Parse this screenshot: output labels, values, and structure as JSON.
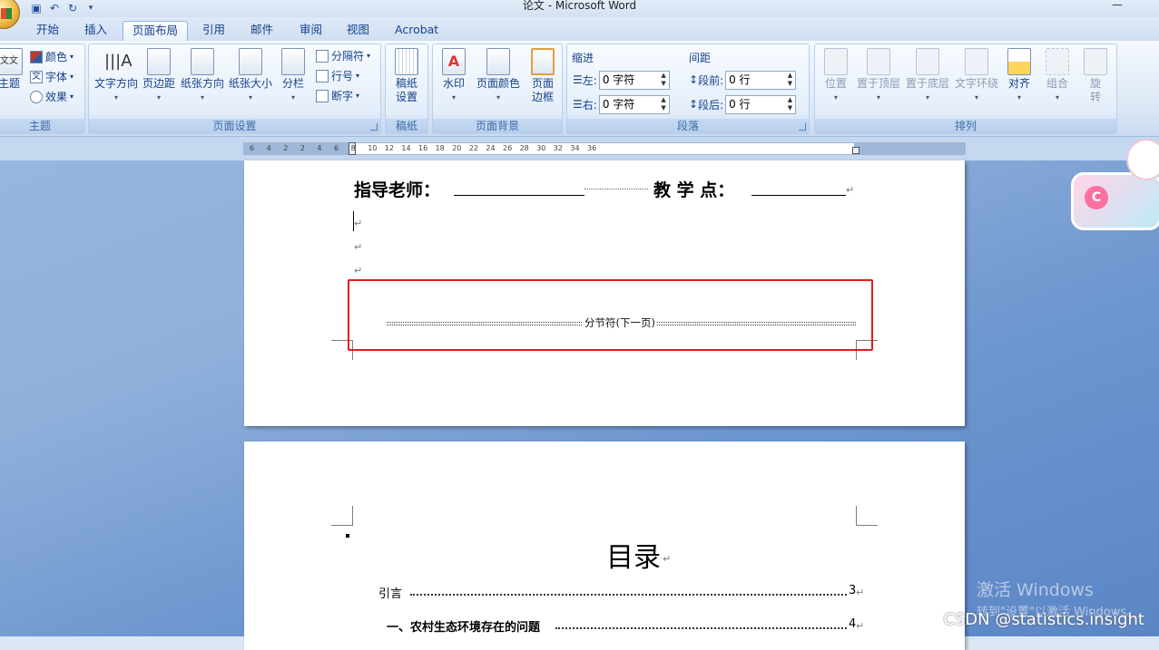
{
  "window": {
    "title": "论文 - Microsoft Word"
  },
  "quick_access": {
    "items": [
      "save-icon",
      "undo-icon",
      "redo-icon",
      "customize-icon"
    ]
  },
  "tabs": [
    {
      "label": "开始",
      "active": false
    },
    {
      "label": "插入",
      "active": false
    },
    {
      "label": "页面布局",
      "active": true
    },
    {
      "label": "引用",
      "active": false
    },
    {
      "label": "邮件",
      "active": false
    },
    {
      "label": "审阅",
      "active": false
    },
    {
      "label": "视图",
      "active": false
    },
    {
      "label": "Acrobat",
      "active": false
    }
  ],
  "ribbon": {
    "theme_group": {
      "label": "主题",
      "big": "主题",
      "colors": "颜色",
      "fonts": "字体",
      "effects": "效果"
    },
    "page_setup_group": {
      "label": "页面设置",
      "text_direction": "文字方向",
      "margins": "页边距",
      "orientation": "纸张方向",
      "size": "纸张大小",
      "columns": "分栏",
      "breaks": "分隔符",
      "line_numbers": "行号",
      "hyphenation": "断字"
    },
    "manuscript_group": {
      "label": "稿纸",
      "button_line1": "稿纸",
      "button_line2": "设置"
    },
    "page_background_group": {
      "label": "页面背景",
      "watermark": "水印",
      "page_color": "页面颜色",
      "page_borders_line1": "页面",
      "page_borders_line2": "边框"
    },
    "paragraph_group": {
      "label": "段落",
      "indent_title": "缩进",
      "spacing_title": "间距",
      "left_label": "左:",
      "left_value": "0 字符",
      "right_label": "右:",
      "right_value": "0 字符",
      "before_label": "段前:",
      "before_value": "0 行",
      "after_label": "段后:",
      "after_value": "0 行"
    },
    "arrange_group": {
      "label": "排列",
      "position": "位置",
      "bring_front": "置于顶层",
      "send_back": "置于底层",
      "text_wrap": "文字环绕",
      "align": "对齐",
      "group": "组合",
      "rotate_line1": "旋",
      "rotate_line2": "转"
    }
  },
  "ruler": {
    "numbers": [
      "6",
      "4",
      "2",
      "2",
      "4",
      "6",
      "8",
      "10",
      "12",
      "14",
      "16",
      "18",
      "20",
      "22",
      "24",
      "26",
      "28",
      "30",
      "32",
      "34",
      "36"
    ]
  },
  "document": {
    "page1": {
      "advisor_label": "指导老师：",
      "teaching_point_label": "教 学 点：",
      "para_mark": "↵",
      "section_break_label": "分节符(下一页)"
    },
    "page2": {
      "toc_title": "目录",
      "toc_entries": [
        {
          "text": "引言",
          "page": "3"
        },
        {
          "text": "一、农村生态环境存在的问题",
          "page": "4"
        }
      ]
    }
  },
  "overlays": {
    "activation_line1": "激活 Windows",
    "activation_line2": "转到\"设置\"以激活 Windows。",
    "csdn": "CSDN @statistics.insight",
    "deco_letter": "C"
  },
  "colors": {
    "highlight_box": "#e81919",
    "ribbon_text": "#15428b"
  }
}
